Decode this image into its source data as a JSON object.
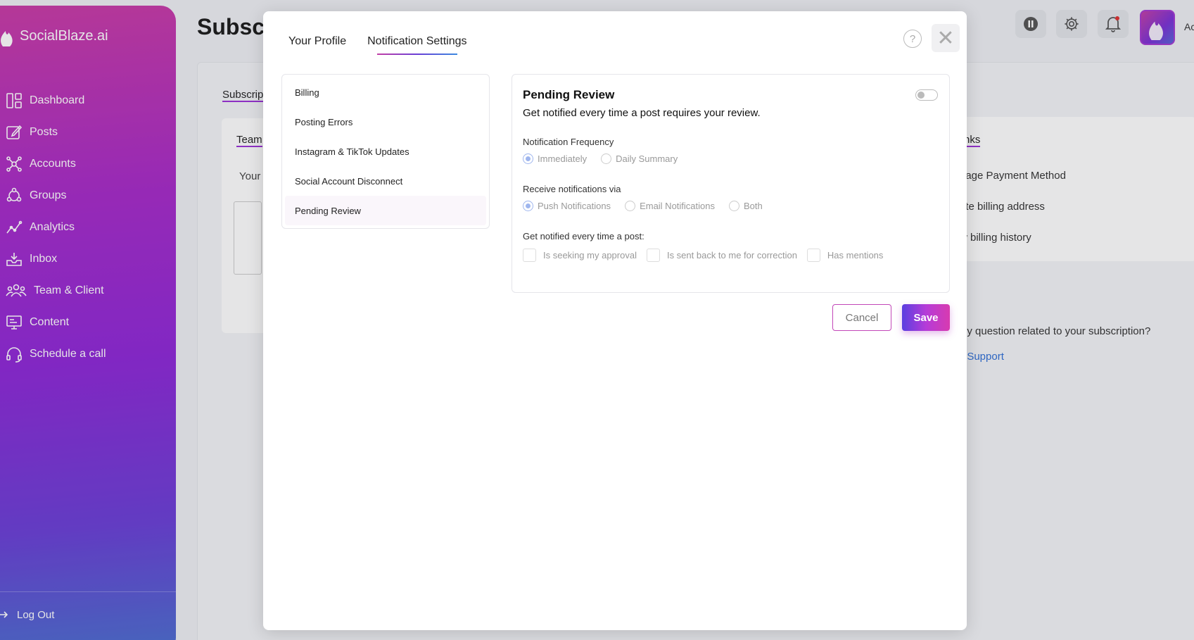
{
  "sidebar": {
    "brand": "SocialBlaze.ai",
    "items": [
      {
        "label": "Dashboard",
        "icon": "dashboard-icon"
      },
      {
        "label": "Posts",
        "icon": "edit-icon"
      },
      {
        "label": "Accounts",
        "icon": "network-icon"
      },
      {
        "label": "Groups",
        "icon": "groups-icon"
      },
      {
        "label": "Analytics",
        "icon": "chart-icon"
      },
      {
        "label": "Inbox",
        "icon": "inbox-icon"
      },
      {
        "label": "Team & Client",
        "icon": "team-icon"
      },
      {
        "label": "Content",
        "icon": "monitor-icon"
      },
      {
        "label": "Schedule a call",
        "icon": "headset-icon"
      }
    ],
    "logout": "Log Out"
  },
  "background": {
    "page_title": "Subsc",
    "subscription_tab": "Subscrip",
    "team_tab": "Team",
    "your_text": "Your",
    "links_title": "nks",
    "links": [
      "nage Payment Method",
      "ate billing address",
      "w billing history"
    ],
    "question": "ny question related to your subscription?",
    "support": "t Support",
    "admin": "Ac"
  },
  "modal": {
    "tabs": [
      "Your Profile",
      "Notification Settings"
    ],
    "active_tab": "Notification Settings",
    "help": "?",
    "close": "✕",
    "categories": [
      "Billing",
      "Posting Errors",
      "Instagram & TikTok Updates",
      "Social Account Disconnect",
      "Pending Review"
    ],
    "active_category": "Pending Review",
    "panel": {
      "title": "Pending Review",
      "description": "Get notified every time a post requires your review.",
      "enabled": false,
      "frequency_label": "Notification Frequency",
      "frequency_options": [
        "Immediately",
        "Daily Summary"
      ],
      "frequency_selected": "Immediately",
      "via_label": "Receive notifications via",
      "via_options": [
        "Push Notifications",
        "Email Notifications",
        "Both"
      ],
      "via_selected": "Push Notifications",
      "post_label": "Get notified every time a post:",
      "post_options": [
        "Is seeking my approval",
        "Is sent back to me for correction",
        "Has mentions"
      ]
    },
    "cancel": "Cancel",
    "save": "Save"
  }
}
